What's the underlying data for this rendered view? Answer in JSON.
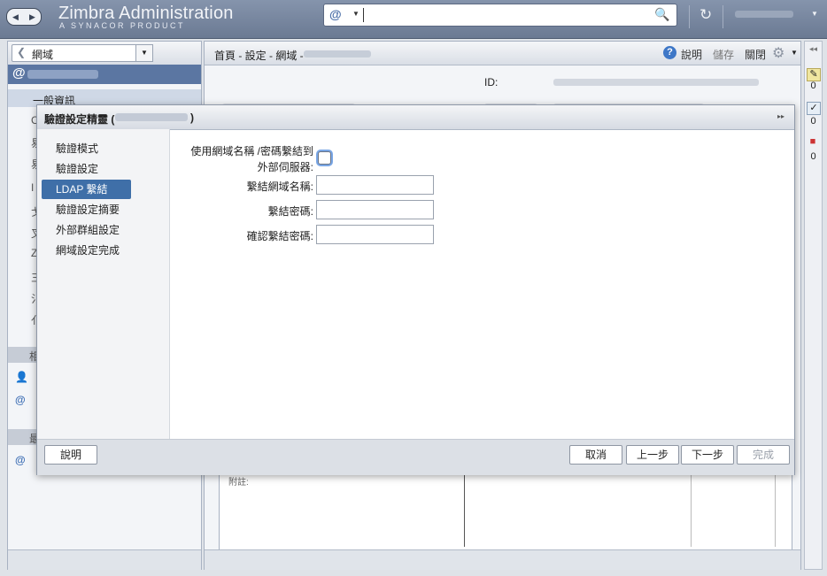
{
  "topbar": {
    "brand": "Zimbra Administration",
    "brand_sub": "A SYNACOR PRODUCT",
    "search_scope": "@"
  },
  "left": {
    "back_label": "網域",
    "partial_item": "一般資訊"
  },
  "content": {
    "breadcrumb": "首頁 - 設定 - 網域 -",
    "help": "說明",
    "save": "儲存",
    "close": "關閉",
    "id_label": "ID:",
    "note": "附註:"
  },
  "rail": {
    "counts": [
      "0",
      "0",
      "0"
    ]
  },
  "wizard": {
    "title_prefix": "驗證設定精靈 (",
    "title_suffix": ")",
    "steps": [
      "驗證模式",
      "驗證設定",
      "LDAP 繫結",
      "驗證設定摘要",
      "外部群組設定",
      "網域設定完成"
    ],
    "active_step": 2,
    "form": {
      "use_bind_label_line1": "使用網域名稱 /密碼繫結到",
      "use_bind_label_line2": "外部伺服器:",
      "use_bind_checked": false,
      "bind_dn_label": "繫結網域名稱:",
      "bind_dn_value": "",
      "bind_password_label": "繫結密碼:",
      "bind_password_value": "",
      "confirm_password_label": "確認繫結密碼:",
      "confirm_password_value": ""
    },
    "buttons": {
      "help": "說明",
      "cancel": "取消",
      "prev": "上一步",
      "next": "下一步",
      "finish": "完成"
    }
  }
}
